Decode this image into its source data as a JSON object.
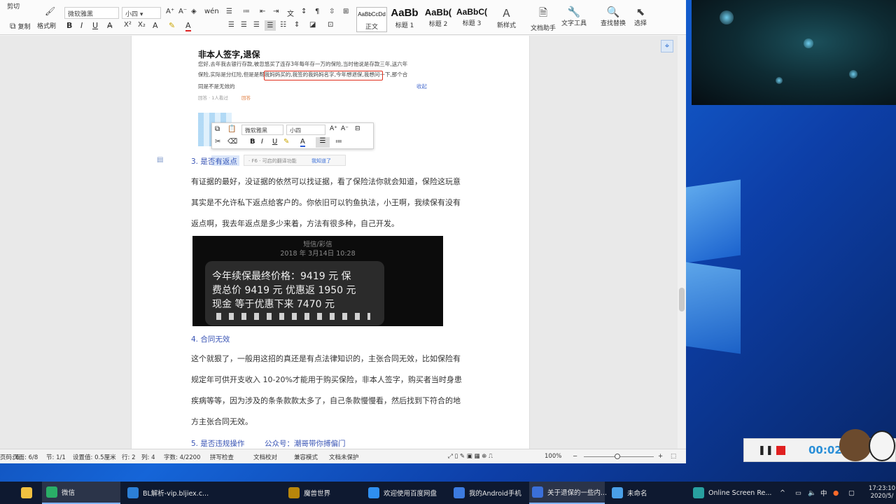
{
  "ribbon": {
    "top_left_partial": "剪切",
    "copy": "复制",
    "format_painter": "格式刷",
    "font_name": "微软雅黑",
    "font_size": "小四",
    "styles": [
      {
        "preview": "AaBbCcDd",
        "name": "正文"
      },
      {
        "preview": "AaBb",
        "name": "标题 1"
      },
      {
        "preview": "AaBb(",
        "name": "标题 2"
      },
      {
        "preview": "AaBbC(",
        "name": "标题 3"
      }
    ],
    "new_style": "新样式",
    "doc_helper": "文档助手",
    "text_tools": "文字工具",
    "find_replace": "查找替换",
    "select": "选择"
  },
  "document": {
    "title": "非本人签字,退保",
    "quote_line1": "您好,去年我去银行存款,被忽悠买了连存3年每年存一万的保险,当时他说是存款三年,送六年",
    "quote_line2": "保险,实际是分红险,但是是帮我妈妈买的,我签的我妈妈名字,今年想退保,我想问一下,那个合",
    "quote_line3": "同是不是无效的",
    "quote_collapse": "收起",
    "quote_meta_1": "回答 · 1人看过",
    "quote_meta_2": "回答",
    "section3_heading": "3. 是否有返点",
    "tooltip_hint": "· F6 · 可启的翻译功能",
    "tooltip_ok": "我知道了",
    "para3_line1": "有证据的最好，没证据的依然可以找证据，看了保险法你就会知道，保险这玩意",
    "para3_line2": "其实是不允许私下返点给客户的。你依旧可以钓鱼执法，小王啊，我续保有没有",
    "para3_line3": "返点啊，我去年返点是多少来着，方法有很多种，自己开发。",
    "sms_header": "短信/彩信",
    "sms_date": "2018 年 3月14日 10:28",
    "sms_line1": "今年续保最终价格：9419 元 保",
    "sms_line2": "费总价 9419 元 优惠返 1950 元",
    "sms_line3": "现金 等于优惠下来 7470 元",
    "section4_heading": "4.  合同无效",
    "para4_line1": "这个就狠了，一般用这招的真还是有点法律知识的，主张合同无效，比如保险有",
    "para4_line2": "规定年可供开支收入 10-20%才能用于购买保险，非本人签字，购买者当时身患",
    "para4_line3": "疾病等等，因为涉及的条条款款太多了，自己条款慢慢看，然后找到下符合的地",
    "para4_line4": "方主张合同无效。",
    "section5_heading": "5.  是否违规操作",
    "section5_extra": "公众号：潮哥带你搏偏门"
  },
  "floatbar": {
    "font": "微软雅黑",
    "size": "小四"
  },
  "statusbar": {
    "page_num": "页码: 6",
    "page": "页面: 6/8",
    "section": "节: 1/1",
    "set_value": "设置值: 0.5厘米",
    "row": "行: 2",
    "col": "列: 4",
    "words": "字数: 4/2200",
    "spell": "拼写检查",
    "proof": "文档校对",
    "compat": "兼容模式",
    "unprotected": "文档未保护",
    "zoom": "100%"
  },
  "recorder": {
    "time": "00:02"
  },
  "taskbar": {
    "items": [
      {
        "label": "微信",
        "color": "#2aae67"
      },
      {
        "label": "BL解析-vip.bljiex.c...",
        "color": "#2c7fd6"
      },
      {
        "label": "魔兽世界",
        "color": "#b8860b"
      },
      {
        "label": "欢迎使用百度网盘",
        "color": "#2f8ff0"
      },
      {
        "label": "我的Android手机",
        "color": "#3c7be0"
      },
      {
        "label": "关于退保的一些内...",
        "color": "#3a6fd8"
      },
      {
        "label": "未命名",
        "color": "#4aa0e8"
      },
      {
        "label": "Online Screen Re...",
        "color": "#28a0a0"
      }
    ],
    "time": "17:23:10",
    "date": "2020/5/",
    "ime": "中"
  }
}
